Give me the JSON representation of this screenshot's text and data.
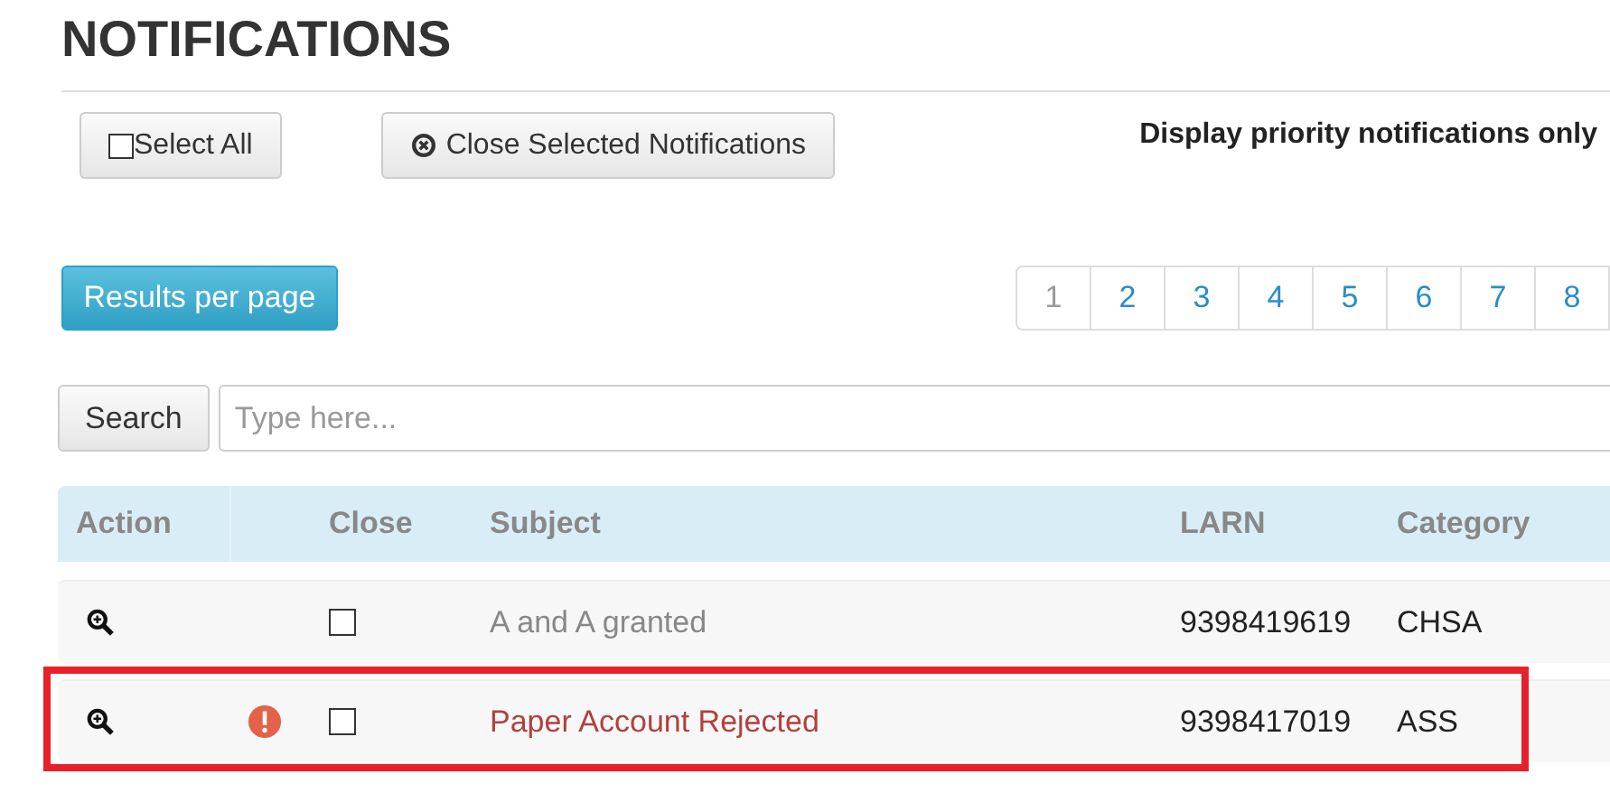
{
  "title": "NOTIFICATIONS",
  "select_all": {
    "label": "Select All",
    "checked": false
  },
  "close_button": {
    "label": "Close Selected Notifications"
  },
  "priority_filter": {
    "label": "Display priority notifications only"
  },
  "results_button": {
    "label": "Results per page"
  },
  "pages": [
    {
      "label": "1",
      "selected": true
    },
    {
      "label": "2",
      "selected": false
    },
    {
      "label": "3",
      "selected": false
    },
    {
      "label": "4",
      "selected": false
    },
    {
      "label": "5",
      "selected": false
    },
    {
      "label": "6",
      "selected": false
    },
    {
      "label": "7",
      "selected": false
    },
    {
      "label": "8",
      "selected": false
    }
  ],
  "search": {
    "button": "Search",
    "placeholder": "Type here..."
  },
  "table": {
    "columns": [
      "Action",
      "Close",
      "Subject",
      "LARN",
      "Category"
    ],
    "rows": [
      {
        "priority": false,
        "checked": false,
        "subject": "A and A granted",
        "larn": "9398419619",
        "category": "CHSA",
        "highlighted": false
      },
      {
        "priority": true,
        "checked": false,
        "subject": "Paper Account Rejected",
        "larn": "9398417019",
        "category": "ASS",
        "highlighted": true
      }
    ]
  }
}
